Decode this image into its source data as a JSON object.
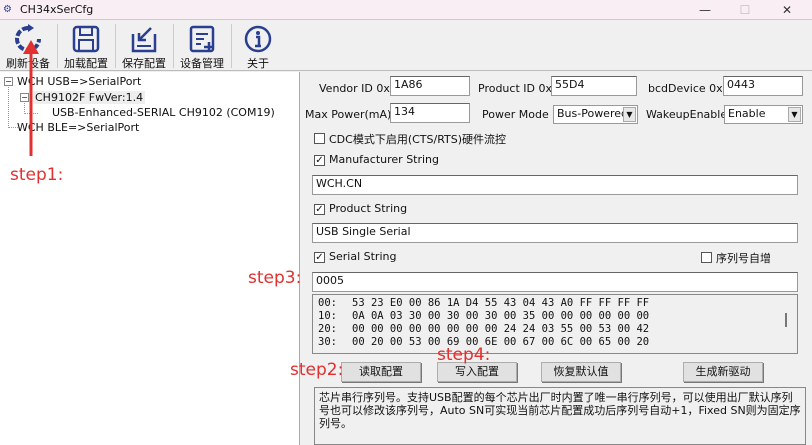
{
  "window": {
    "title": "CH34xSerCfg",
    "minimize": "—",
    "maximize": "☐",
    "close": "✕"
  },
  "toolbar": [
    {
      "label": "刷新设备",
      "icon": "refresh-icon"
    },
    {
      "label": "加载配置",
      "icon": "floppy-icon"
    },
    {
      "label": "保存配置",
      "icon": "save-down-icon"
    },
    {
      "label": "设备管理",
      "icon": "device-manage-icon"
    },
    {
      "label": "关于",
      "icon": "info-icon"
    }
  ],
  "tree": {
    "usb": "WCH USB=>SerialPort",
    "chip": "CH9102F FwVer:1.4",
    "port": "USB-Enhanced-SERIAL CH9102 (COM19)",
    "ble": "WCH BLE=>SerialPort",
    "expander": "−"
  },
  "fields": {
    "vendor_label": "Vendor ID 0x",
    "vendor": "1A86",
    "product_label": "Product ID 0x",
    "product": "55D4",
    "bcd_label": "bcdDevice 0x",
    "bcd": "0443",
    "maxpower_label": "Max Power(mA)",
    "maxpower": "134",
    "powermode_label": "Power Mode",
    "powermode": "Bus-Powered",
    "wakeup_label": "WakeupEnable",
    "wakeup": "Enable"
  },
  "checks": {
    "cdc": "CDC模式下启用(CTS/RTS)硬件流控",
    "cdc_checked": false,
    "manufacturer": "Manufacturer String",
    "manufacturer_checked": true,
    "product": "Product String",
    "product_checked": true,
    "serial": "Serial String",
    "serial_checked": true,
    "autoinc": "序列号自增",
    "autoinc_checked": false,
    "check_mark": "✓"
  },
  "strings": {
    "manufacturer": "WCH.CN",
    "product": "USB Single Serial",
    "serial": "0005"
  },
  "hex": [
    {
      "addr": "00:",
      "bytes": "53 23 E0 00 86 1A D4 55 43 04 43 A0 FF FF FF FF"
    },
    {
      "addr": "10:",
      "bytes": "0A 0A 03 30 00 30 00 30 00 35 00 00 00 00 00 00"
    },
    {
      "addr": "20:",
      "bytes": "00 00 00 00 00 00 00 00 24 24 03 55 00 53 00 42"
    },
    {
      "addr": "30:",
      "bytes": "00 20 00 53 00 69 00 6E 00 67 00 6C 00 65 00 20"
    }
  ],
  "buttons": {
    "read": "读取配置",
    "write": "写入配置",
    "restore": "恢复默认值",
    "driver": "生成新驱动"
  },
  "description": "芯片串行序列号。支持USB配置的每个芯片出厂时内置了唯一串行序列号，可以使用出厂默认序列号也可以修改该序列号，Auto SN可实现当前芯片配置成功后序列号自动+1，Fixed SN则为固定序列号。",
  "annotations": {
    "step1": "step1:",
    "step2": "step2:",
    "step3": "step3:",
    "step4": "step4:"
  },
  "colors": {
    "annotation": "#e03030",
    "icon": "#2a3f8f"
  }
}
